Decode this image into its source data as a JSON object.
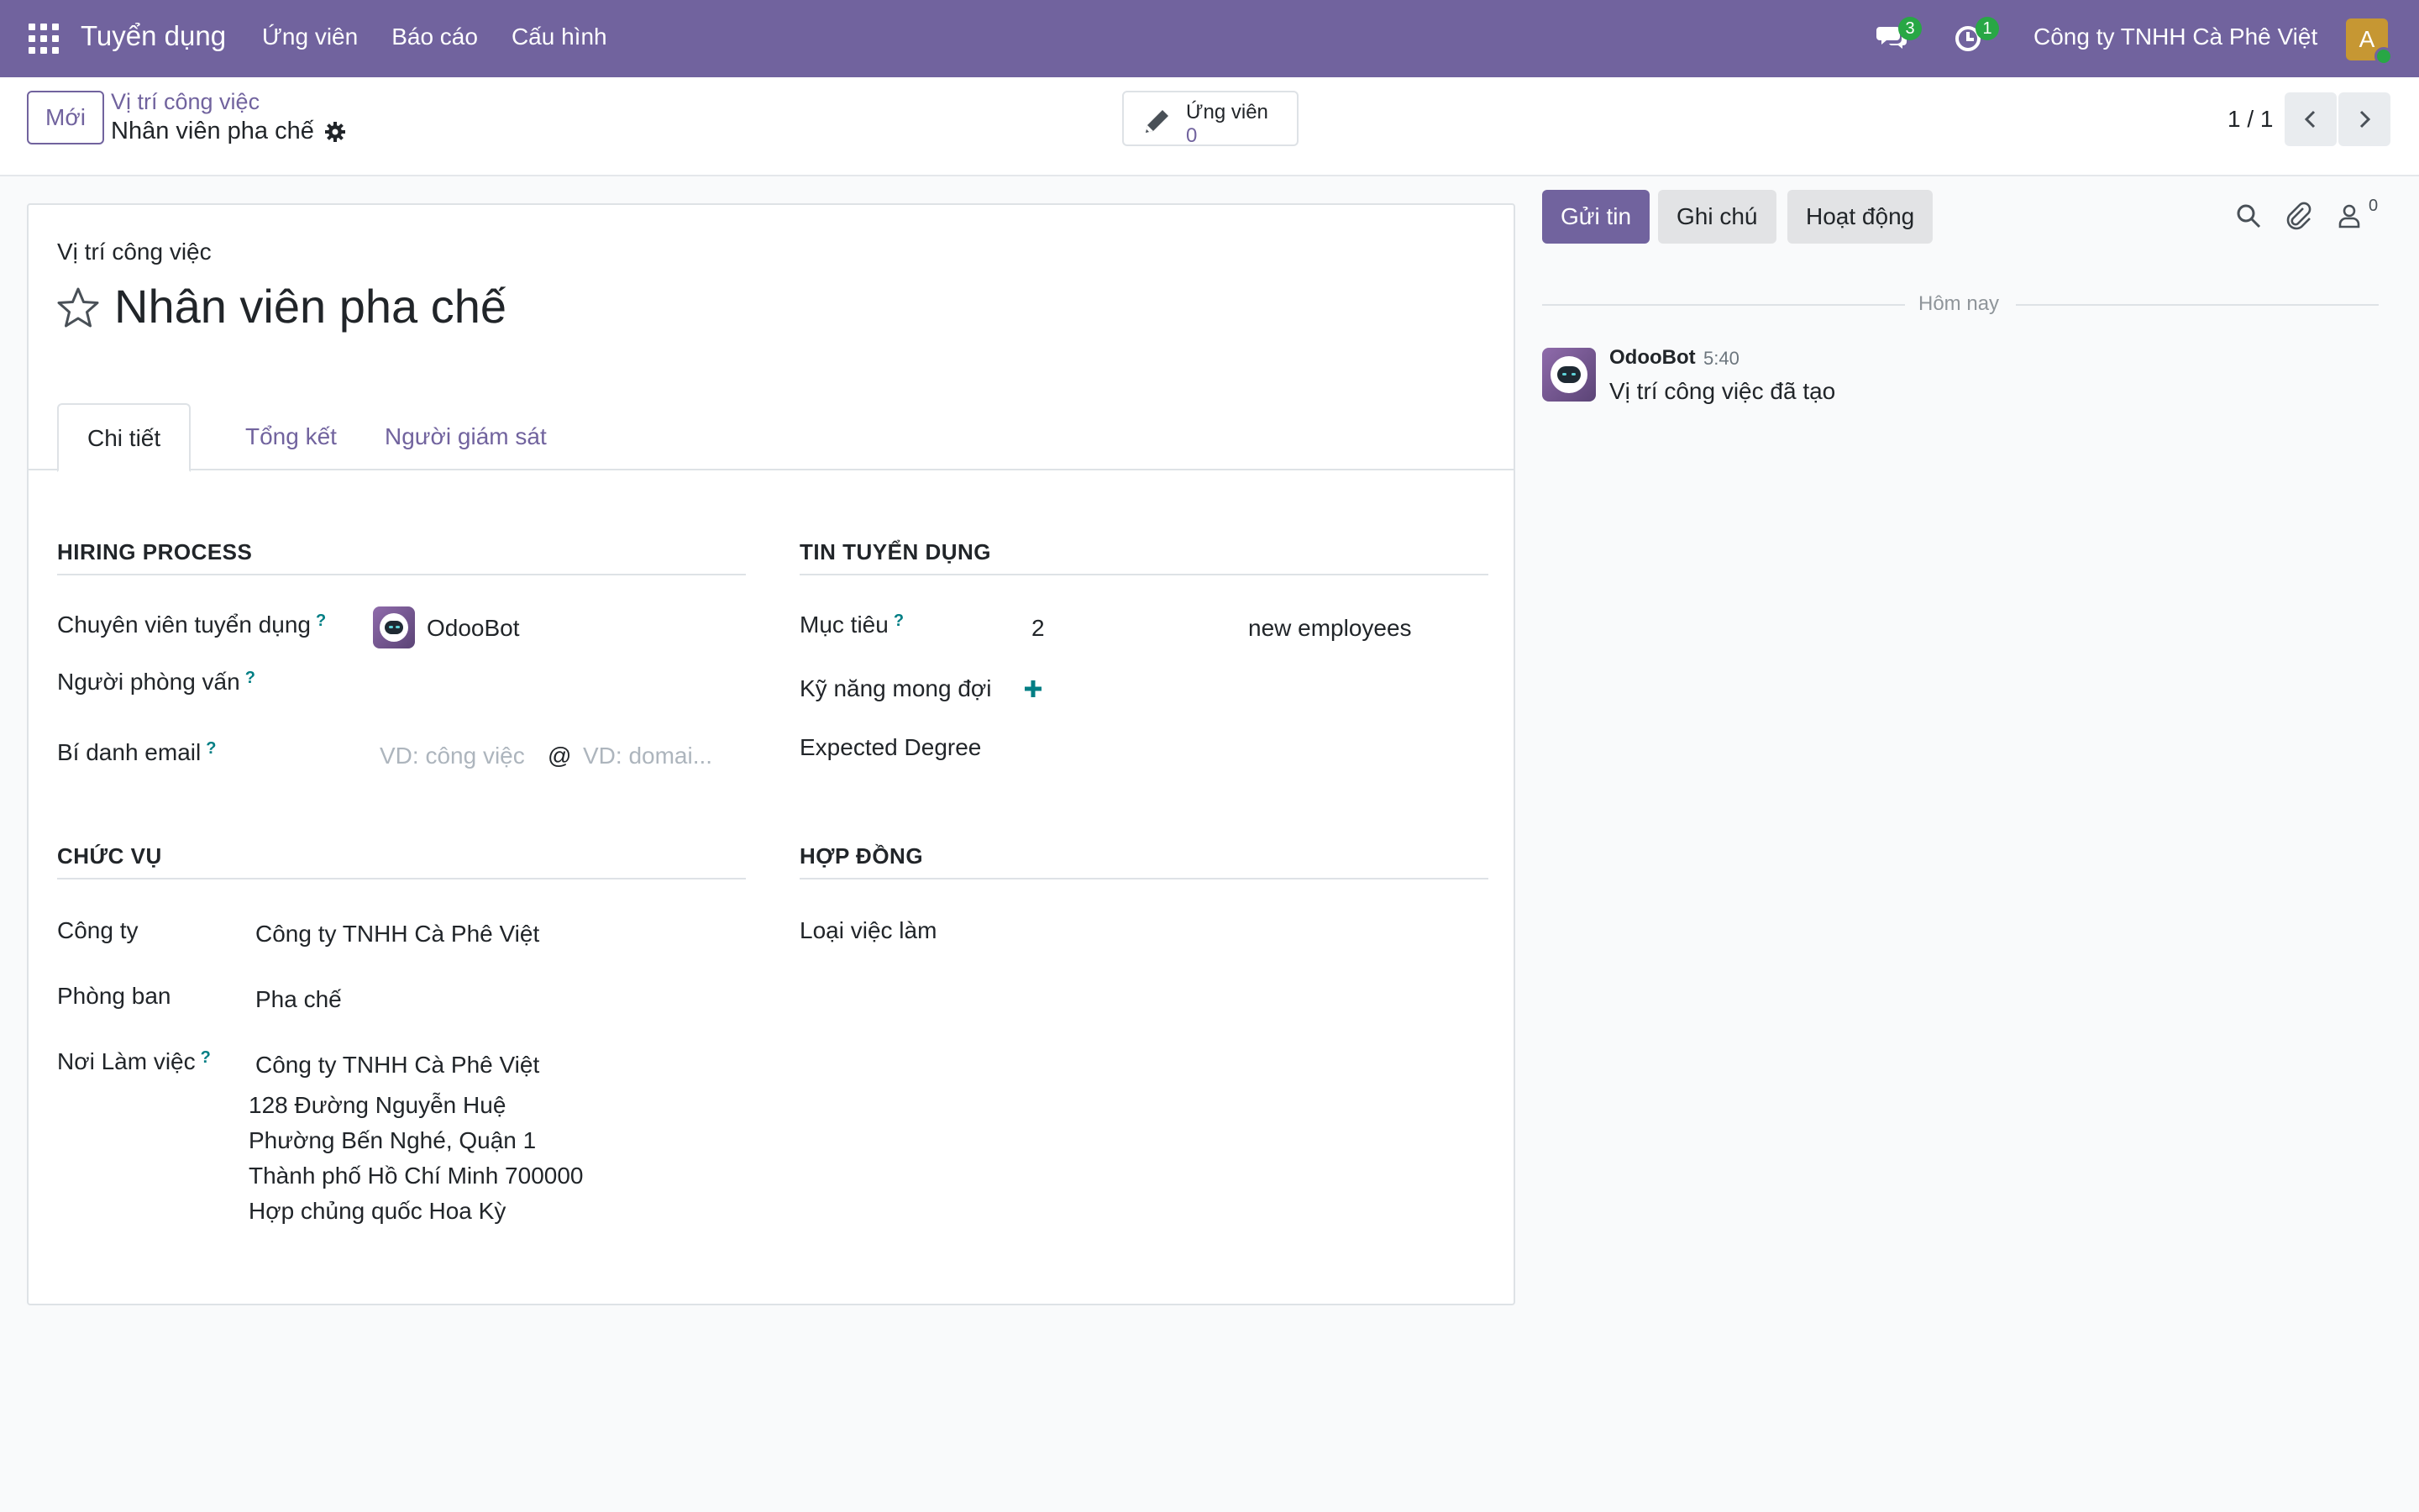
{
  "navbar": {
    "app_title": "Tuyển dụng",
    "menu": [
      "Ứng viên",
      "Báo cáo",
      "Cấu hình"
    ],
    "messages_count": "3",
    "activities_count": "1",
    "company": "Công ty TNHH Cà Phê Việt",
    "user_initial": "A"
  },
  "control": {
    "new_button": "Mới",
    "breadcrumb_parent": "Vị trí công việc",
    "breadcrumb_current": "Nhân viên pha chế",
    "stat_label": "Ứng viên",
    "stat_value": "0",
    "pager": "1 / 1"
  },
  "form": {
    "title_label": "Vị trí công việc",
    "title": "Nhân viên pha chế",
    "tabs": [
      "Chi tiết",
      "Tổng kết",
      "Người giám sát"
    ],
    "hiring": {
      "heading": "HIRING PROCESS",
      "recruiter_label": "Chuyên viên tuyển dụng",
      "recruiter_value": "OdooBot",
      "interviewer_label": "Người phòng vấn",
      "email_alias_label": "Bí danh email",
      "alias_placeholder": "VD: công việc",
      "alias_at": "@",
      "domain_placeholder": "VD: domai..."
    },
    "recruitment": {
      "heading": "TIN TUYỂN DỤNG",
      "target_label": "Mục tiêu",
      "target_value": "2",
      "target_unit": "new employees",
      "skills_label": "Kỹ năng mong đợi",
      "degree_label": "Expected Degree"
    },
    "position": {
      "heading": "CHỨC VỤ",
      "company_label": "Công ty",
      "company_value": "Công ty TNHH Cà Phê Việt",
      "department_label": "Phòng ban",
      "department_value": "Pha chế",
      "workplace_label": "Nơi Làm việc",
      "workplace_name": "Công ty TNHH Cà Phê Việt",
      "address_lines": [
        "128 Đường Nguyễn Huệ",
        "Phường Bến Nghé, Quận 1",
        "Thành phố Hồ Chí Minh 700000",
        "Hợp chủng quốc Hoa Kỳ"
      ]
    },
    "contract": {
      "heading": "HỢP ĐỒNG",
      "employment_type_label": "Loại việc làm"
    },
    "help_mark": "?"
  },
  "chatter": {
    "send_message": "Gửi tin",
    "log_note": "Ghi chú",
    "activities": "Hoạt động",
    "followers_count": "0",
    "date_separator": "Hôm nay",
    "message_author": "OdooBot",
    "message_time": "5:40",
    "message_body": "Vị trí công việc đã tạo"
  }
}
